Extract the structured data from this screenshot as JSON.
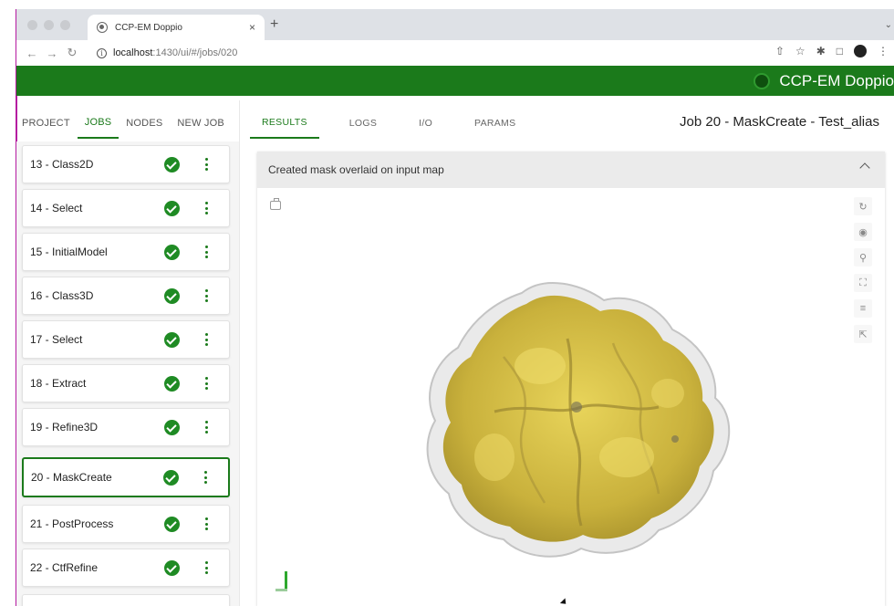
{
  "browser": {
    "tab_title": "CCP-EM Doppio",
    "tab_close": "×",
    "new_tab": "+",
    "url_host": "localhost",
    "url_path": ":1430/ui/#/jobs/020"
  },
  "app": {
    "brand": "CCP-EM Doppio",
    "primary_color": "#1b7a1b"
  },
  "left_tabs": [
    {
      "label": "PROJECT",
      "active": false
    },
    {
      "label": "JOBS",
      "active": true
    },
    {
      "label": "NODES",
      "active": false
    },
    {
      "label": "NEW JOB",
      "active": false
    }
  ],
  "jobs": [
    {
      "label": "13 - Class2D"
    },
    {
      "label": "14 - Select"
    },
    {
      "label": "15 - InitialModel"
    },
    {
      "label": "16 - Class3D"
    },
    {
      "label": "17 - Select"
    },
    {
      "label": "18 - Extract"
    },
    {
      "label": "19 - Refine3D"
    },
    {
      "label": "20 - MaskCreate"
    },
    {
      "label": "21 - PostProcess"
    },
    {
      "label": "22 - CtfRefine"
    }
  ],
  "result_tabs": [
    {
      "label": "RESULTS",
      "active": true
    },
    {
      "label": "LOGS",
      "active": false
    },
    {
      "label": "I/O",
      "active": false
    },
    {
      "label": "PARAMS",
      "active": false
    }
  ],
  "job_title": "Job 20 - MaskCreate - Test_alias",
  "panel": {
    "title": "Created mask overlaid on input map"
  },
  "viewer_tools": [
    "rotate-icon",
    "center-icon",
    "zoom-icon",
    "fullscreen-icon",
    "settings-icon",
    "pointer-icon"
  ]
}
